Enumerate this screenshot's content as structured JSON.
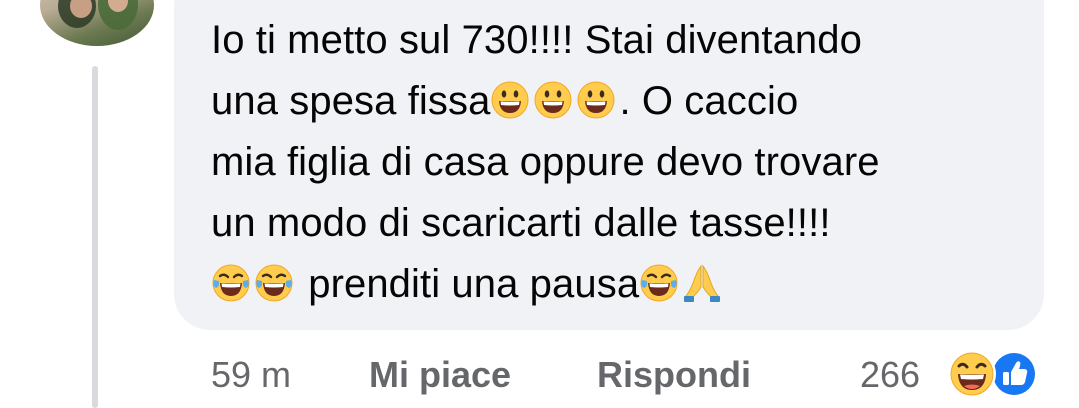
{
  "comment": {
    "lines": [
      {
        "text_a": "Io ti metto sul 730!!!! Stai diventando"
      },
      {
        "text_a": "una spesa fissa",
        "emojis": [
          "grinning-face-icon",
          "grinning-face-icon",
          "grinning-face-icon"
        ],
        "text_b": ". O caccio"
      },
      {
        "text_a": "mia figlia di casa oppure devo trovare"
      },
      {
        "text_a": "un modo di scaricarti dalle tasse!!!!"
      },
      {
        "text_a": "prenditi una pausa"
      }
    ]
  },
  "actions": {
    "time": "59 m",
    "like_label": "Mi piace",
    "reply_label": "Rispondi"
  },
  "reactions": {
    "count": "266",
    "icons": [
      "haha-reaction-icon",
      "like-reaction-icon"
    ]
  },
  "colors": {
    "bubble": "#f0f2f5",
    "meta_text": "#65676b",
    "like_blue": "#1877f2",
    "emoji_yellow": "#ffcc4d"
  }
}
